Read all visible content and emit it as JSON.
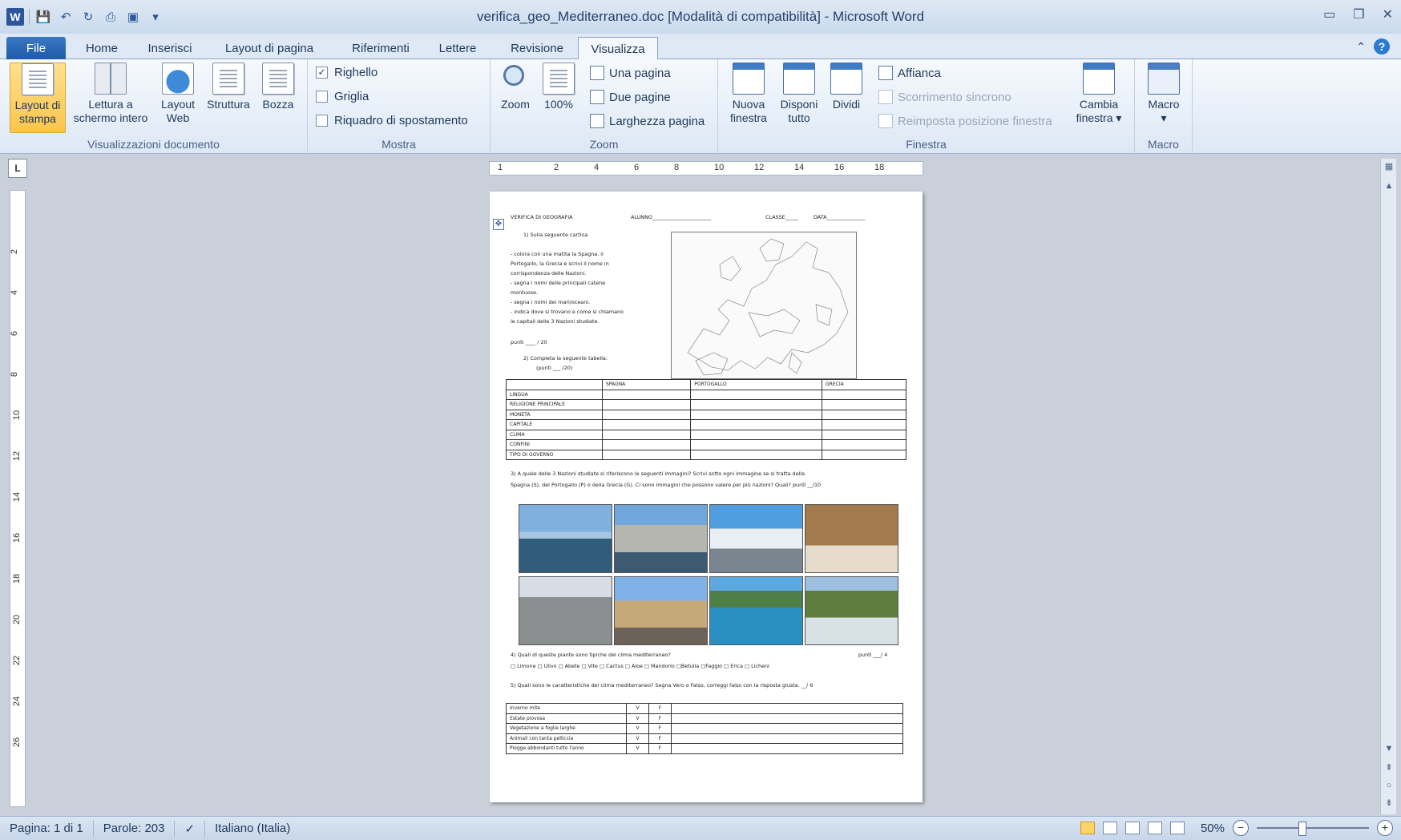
{
  "window": {
    "title": "verifica_geo_Mediterraneo.doc [Modalità di compatibilità] - Microsoft Word",
    "app_icon": "W"
  },
  "tabs": {
    "file": "File",
    "items": [
      "Home",
      "Inserisci",
      "Layout di pagina",
      "Riferimenti",
      "Lettere",
      "Revisione",
      "Visualizza"
    ],
    "active": "Visualizza"
  },
  "ribbon": {
    "views": {
      "label": "Visualizzazioni documento",
      "print_layout": [
        "Layout di",
        "stampa"
      ],
      "full_screen": [
        "Lettura a",
        "schermo intero"
      ],
      "web_layout": [
        "Layout",
        "Web"
      ],
      "outline": "Struttura",
      "draft": "Bozza"
    },
    "show": {
      "label": "Mostra",
      "ruler": "Righello",
      "gridlines": "Griglia",
      "nav_pane": "Riquadro di spostamento",
      "check": "✓"
    },
    "zoom": {
      "label": "Zoom",
      "zoom": "Zoom",
      "hundred": "100%",
      "one_page": "Una pagina",
      "two_pages": "Due pagine",
      "page_width": "Larghezza pagina"
    },
    "window": {
      "label": "Finestra",
      "new_window": [
        "Nuova",
        "finestra"
      ],
      "arrange_all": [
        "Disponi",
        "tutto"
      ],
      "split": "Dividi",
      "side_by_side": "Affianca",
      "sync_scroll": "Scorrimento sincrono",
      "reset_pos": "Reimposta posizione finestra",
      "switch_windows": [
        "Cambia",
        "finestra ▾"
      ]
    },
    "macro": {
      "label": "Macro",
      "macro": "Macro",
      "arrow": "▾"
    }
  },
  "ruler": {
    "corner": "L",
    "h_labels": [
      "1",
      "2",
      "4",
      "6",
      "8",
      "10",
      "12",
      "14",
      "16",
      "18"
    ],
    "v_labels": [
      "2",
      "4",
      "6",
      "8",
      "10",
      "12",
      "14",
      "16",
      "18",
      "20",
      "22",
      "24",
      "26"
    ]
  },
  "document": {
    "header": "VERIFICA DI GEOGRAFIA",
    "alunno": "ALUNNO_______________________",
    "classe": "CLASSE_____",
    "data": "DATA_______________",
    "q1_title": "1)  Sulla seguente cartina",
    "q1_lines": [
      "-    colora con una matita la Spagna, il",
      "      Portogallo, la Grecia e scrivi il nome in",
      "      corrispondenza delle Nazioni.",
      "-    segna i nomi delle principali catene",
      "      montuose.",
      "-    segna i nomi dei mari/oceani.",
      "-    indica dove si trovano e come si chiamano",
      "      le capitali delle 3 Nazioni studiate."
    ],
    "q1_points": "punti ____ / 20",
    "q2_title": "2)  Completa la seguente tabella:",
    "q2_points": "(punti ___ /20)",
    "table1_header": [
      "",
      "SPAGNA",
      "PORTOGALLO",
      "GRECIA"
    ],
    "table1_rows": [
      "LINGUA",
      "RELIGIONE PRINCIPALE",
      "MONETA",
      "CAPITALE",
      "CLIMA",
      "CONFINI",
      "TIPO DI GOVERNO"
    ],
    "q3_line1": "3) A quale delle 3 Nazioni studiate si riferiscono le seguenti immagini? Scrivi sotto ogni immagine se si tratta della",
    "q3_line2": "Spagna (S), del Portogallo (P) o della Grecia (G). Ci sono immagini che possono valere per più nazioni? Quali? punti __/10",
    "q4_line1": "4) Quali di queste piante sono tipiche del clima mediterraneo?",
    "q4_points": "punti ___/ 4",
    "q4_line2": "□ Limone   □ Ulivo   □ Abete   □ Vite   □ Cactus   □ Aloe   □ Mandorlo   □Betulla   □Faggio  □ Erica   □ Licheni",
    "q5_line": "5) Quali sono le caratteristiche del clima mediterraneo? Segna Vero o Falso, correggi falso con la risposta giusta.   __/ 6",
    "table2_rows": [
      [
        "Inverno mite",
        "V",
        "F"
      ],
      [
        "Estate piovosa",
        "V",
        "F"
      ],
      [
        "Vegetazione a foglie larghe",
        "V",
        "F"
      ],
      [
        "Animali con tanta pelliccia",
        "V",
        "F"
      ],
      [
        "Piogge abbondanti tutto l'anno",
        "V",
        "F"
      ]
    ]
  },
  "status": {
    "page": "Pagina: 1 di 1",
    "words": "Parole: 203",
    "language": "Italiano (Italia)",
    "zoom": "50%",
    "minus": "−",
    "plus": "+"
  },
  "colors": {
    "accent": "#2b579a",
    "selected_button": "#fbc54c"
  }
}
